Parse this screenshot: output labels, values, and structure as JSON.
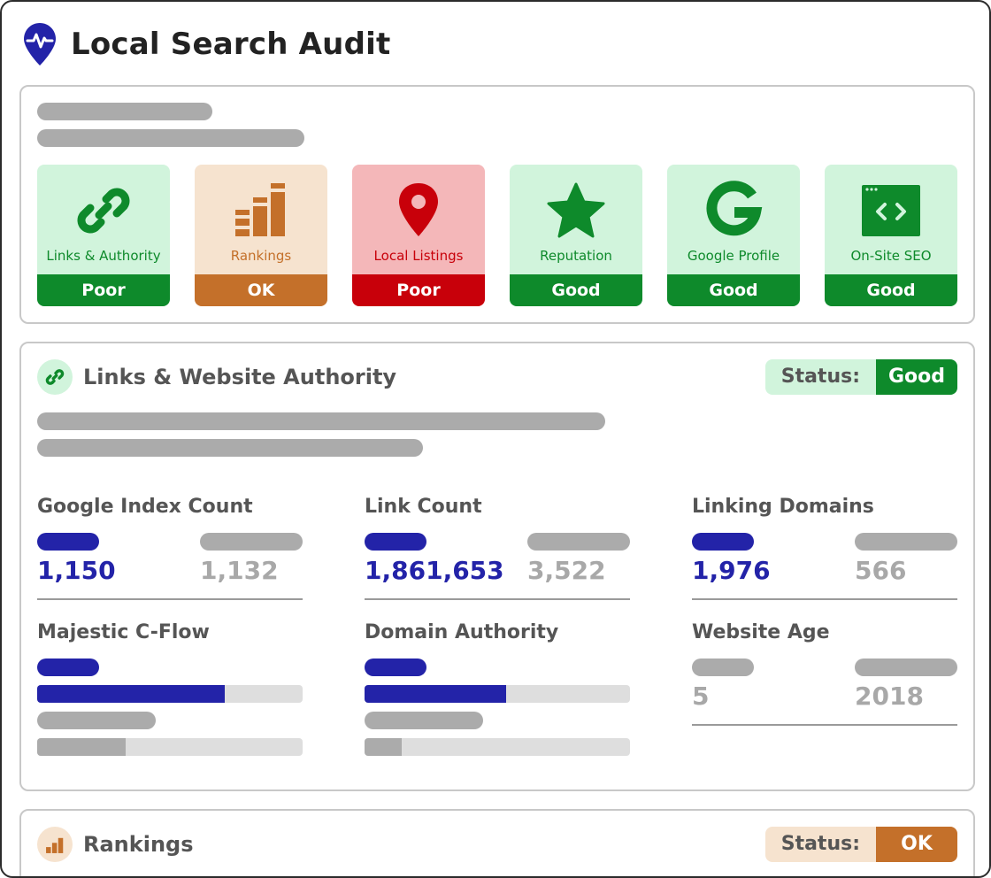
{
  "app": {
    "title": "Local Search Audit",
    "logo_icon": "map-pin-heartbeat-icon"
  },
  "colors": {
    "good": "#0e8a2b",
    "good_bg": "#d1f4dc",
    "ok": "#c4702a",
    "ok_bg": "#f6e3cf",
    "poor": "#c8000a",
    "poor_bg": "#f4b7b9",
    "accent_blue": "#2323a8"
  },
  "categories": [
    {
      "label": "Links & Authority",
      "status": "Poor",
      "icon": "link-icon",
      "tone": "good"
    },
    {
      "label": "Rankings",
      "status": "OK",
      "icon": "bar-chart-icon",
      "tone": "ok"
    },
    {
      "label": "Local Listings",
      "status": "Poor",
      "icon": "map-pin-icon",
      "tone": "poor"
    },
    {
      "label": "Reputation",
      "status": "Good",
      "icon": "star-icon",
      "tone": "good"
    },
    {
      "label": "Google Profile",
      "status": "Good",
      "icon": "google-icon",
      "tone": "good"
    },
    {
      "label": "On-Site SEO",
      "status": "Good",
      "icon": "code-window-icon",
      "tone": "good"
    }
  ],
  "links_section": {
    "title": "Links & Website Authority",
    "icon": "link-icon",
    "status_label": "Status:",
    "status_value": "Good",
    "metrics": [
      {
        "title": "Google Index Count",
        "value": "1,150",
        "compare": "1,132"
      },
      {
        "title": "Link Count",
        "value": "1,861,653",
        "compare": "3,522"
      },
      {
        "title": "Linking Domains",
        "value": "1,976",
        "compare": "566"
      },
      {
        "title": "Majestic C-Flow",
        "fill": 0.707,
        "compare_fill": 0.333
      },
      {
        "title": "Domain Authority",
        "fill": 0.533,
        "compare_fill": 0.14
      },
      {
        "title": "Website Age",
        "value": "5",
        "compare": "2018"
      }
    ]
  },
  "rankings_section": {
    "title": "Rankings",
    "icon": "bar-chart-icon",
    "status_label": "Status:",
    "status_value": "OK"
  }
}
